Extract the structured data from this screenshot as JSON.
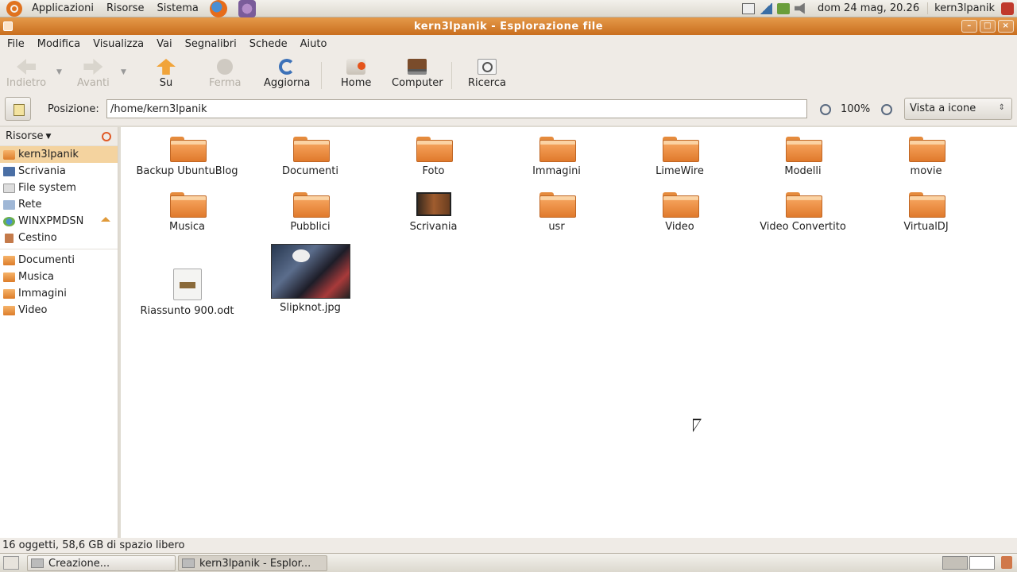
{
  "top_panel": {
    "menus": [
      "Applicazioni",
      "Risorse",
      "Sistema"
    ],
    "clock": "dom 24 mag, 20.26",
    "user": "kern3lpanik"
  },
  "window": {
    "title": "kern3lpanik - Esplorazione file",
    "menubar": [
      "File",
      "Modifica",
      "Visualizza",
      "Vai",
      "Segnalibri",
      "Schede",
      "Aiuto"
    ]
  },
  "toolbar": {
    "back": "Indietro",
    "forward": "Avanti",
    "up": "Su",
    "stop": "Ferma",
    "reload": "Aggiorna",
    "home": "Home",
    "computer": "Computer",
    "search": "Ricerca"
  },
  "location": {
    "label": "Posizione:",
    "path": "/home/kern3lpanik",
    "zoom": "100%",
    "view_mode": "Vista a icone"
  },
  "sidebar": {
    "header": "Risorse",
    "places": [
      {
        "label": "kern3lpanik",
        "icon": "home-folder-icon",
        "selected": true
      },
      {
        "label": "Scrivania",
        "icon": "desktop-icon"
      },
      {
        "label": "File system",
        "icon": "filesystem-icon"
      },
      {
        "label": "Rete",
        "icon": "network-icon"
      },
      {
        "label": "WINXPMDSN",
        "icon": "windows-drive-icon",
        "eject": true
      },
      {
        "label": "Cestino",
        "icon": "trash-icon"
      }
    ],
    "bookmarks": [
      "Documenti",
      "Musica",
      "Immagini",
      "Video"
    ]
  },
  "files": [
    {
      "name": "Backup UbuntuBlog",
      "type": "folder"
    },
    {
      "name": "Documenti",
      "type": "folder"
    },
    {
      "name": "Foto",
      "type": "folder"
    },
    {
      "name": "Immagini",
      "type": "folder"
    },
    {
      "name": "LimeWire",
      "type": "folder"
    },
    {
      "name": "Modelli",
      "type": "folder"
    },
    {
      "name": "movie",
      "type": "folder"
    },
    {
      "name": "Musica",
      "type": "folder"
    },
    {
      "name": "Pubblici",
      "type": "folder"
    },
    {
      "name": "Scrivania",
      "type": "desktop"
    },
    {
      "name": "usr",
      "type": "folder"
    },
    {
      "name": "Video",
      "type": "folder"
    },
    {
      "name": "Video Convertito",
      "type": "folder"
    },
    {
      "name": "VirtualDJ",
      "type": "folder"
    },
    {
      "name": "Riassunto 900.odt",
      "type": "document"
    },
    {
      "name": "Slipknot.jpg",
      "type": "image"
    }
  ],
  "status": "16 oggetti, 58,6 GB di spazio libero",
  "taskbar": {
    "tasks": [
      "Creazione...",
      "kern3lpanik - Esplor..."
    ]
  },
  "colors": {
    "titlebar": "#d57d2a",
    "selection": "#f4d39f",
    "folder": "#e88a38"
  }
}
